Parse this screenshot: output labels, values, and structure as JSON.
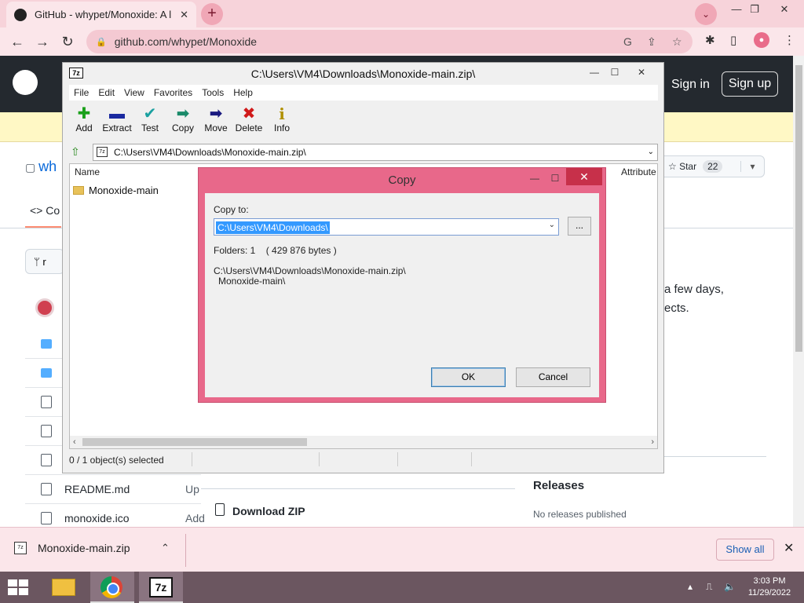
{
  "browser": {
    "tab_title": "GitHub - whypet/Monoxide: A litt",
    "tab_close": "✕",
    "new_tab": "+",
    "url": "github.com/whypet/Monoxide",
    "window_controls": [
      "—",
      "❐",
      "✕"
    ]
  },
  "github": {
    "sign_in": "Sign in",
    "sign_up": "Sign up",
    "repo_name_fragment": "wh",
    "code_tab_fragment": "<> Co",
    "star_label": "Star",
    "star_count": "22",
    "branch_fragment": "r",
    "about_line1": "a few days,",
    "about_line2": "ects.",
    "files": [
      {
        "name": "README.md",
        "extra": "Up"
      },
      {
        "name": "monoxide.ico",
        "extra": "Add"
      }
    ],
    "download_zip": "Download ZIP",
    "releases_title": "Releases",
    "no_releases": "No releases published"
  },
  "sevenzip": {
    "app_icon": "7z",
    "title": "C:\\Users\\VM4\\Downloads\\Monoxide-main.zip\\",
    "menu": [
      "File",
      "Edit",
      "View",
      "Favorites",
      "Tools",
      "Help"
    ],
    "toolbar": [
      {
        "label": "Add",
        "icon": "add-icon",
        "glyph": "✚",
        "color": "#1aa01a"
      },
      {
        "label": "Extract",
        "icon": "extract-icon",
        "glyph": "▬",
        "color": "#1a2aa0"
      },
      {
        "label": "Test",
        "icon": "test-icon",
        "glyph": "✔",
        "color": "#1aa0a0"
      },
      {
        "label": "Copy",
        "icon": "copy-icon",
        "glyph": "➡",
        "color": "#1a8a6a"
      },
      {
        "label": "Move",
        "icon": "move-icon",
        "glyph": "➡",
        "color": "#1a1a80"
      },
      {
        "label": "Delete",
        "icon": "delete-icon",
        "glyph": "✖",
        "color": "#d01a1a"
      },
      {
        "label": "Info",
        "icon": "info-icon",
        "glyph": "i",
        "color": "#b09000"
      }
    ],
    "address": "C:\\Users\\VM4\\Downloads\\Monoxide-main.zip\\",
    "columns": {
      "name": "Name",
      "attributes": "Attribute"
    },
    "items": [
      "Monoxide-main"
    ],
    "status": "0 / 1 object(s) selected"
  },
  "copy_dialog": {
    "title": "Copy",
    "copy_to_label": "Copy to:",
    "copy_to_value": "C:\\Users\\VM4\\Downloads\\",
    "browse": "...",
    "folders_info": "Folders: 1    ( 429 876 bytes )",
    "source_path": "C:\\Users\\VM4\\Downloads\\Monoxide-main.zip\\",
    "source_item": "Monoxide-main\\",
    "ok": "OK",
    "cancel": "Cancel"
  },
  "download_bar": {
    "file": "Monoxide-main.zip",
    "show_all": "Show all",
    "close": "✕"
  },
  "taskbar": {
    "sevenzip_label": "7z",
    "time": "3:03 PM",
    "date": "11/29/2022"
  }
}
